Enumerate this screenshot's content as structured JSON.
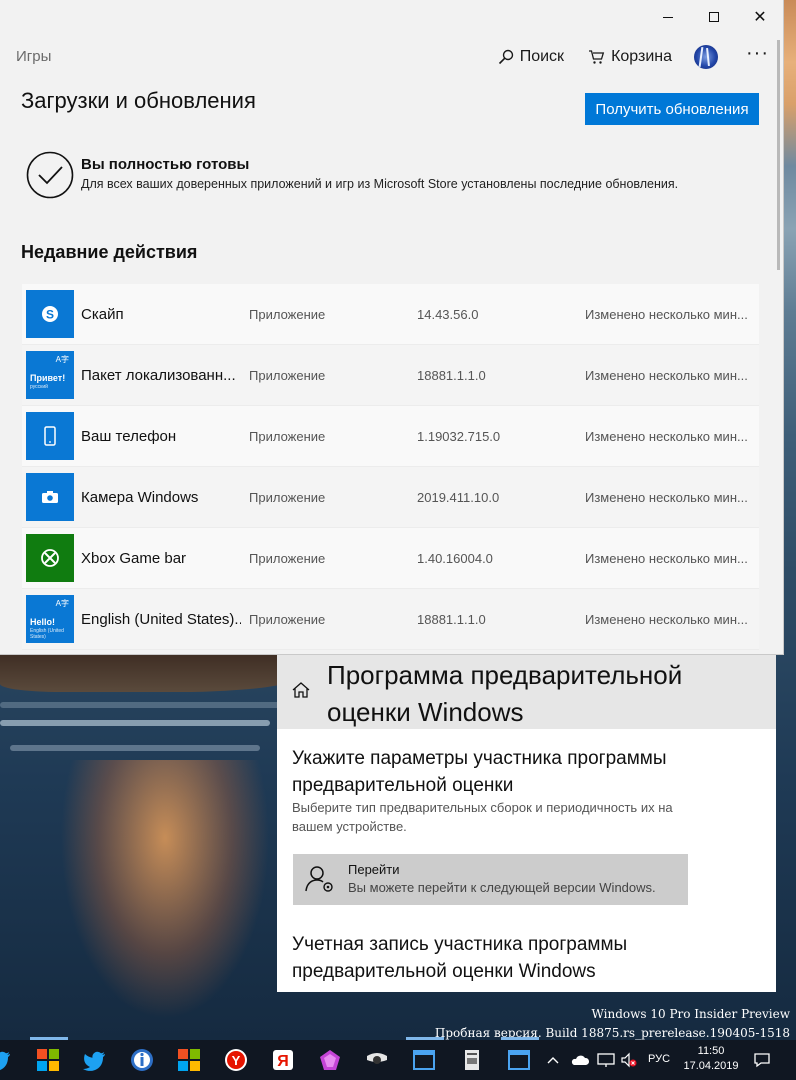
{
  "store": {
    "section": "Игры",
    "nav": {
      "search": "Поиск",
      "cart": "Корзина",
      "more": "···"
    },
    "page_title": "Загрузки и обновления",
    "get_updates_button": "Получить обновления",
    "status_title": "Вы полностью готовы",
    "status_desc": "Для всех ваших доверенных приложений и игр из Microsoft Store установлены последние обновления.",
    "recent_title": "Недавние действия",
    "rows": [
      {
        "name": "Скайп",
        "type": "Приложение",
        "version": "14.43.56.0",
        "status": "Изменено несколько мин...",
        "icon": "skype-icon"
      },
      {
        "name": "Пакет локализованн...",
        "type": "Приложение",
        "version": "18881.1.1.0",
        "status": "Изменено несколько мин...",
        "icon": "language-pack-icon",
        "tile_text": "Привет!",
        "tile_sub": "русский"
      },
      {
        "name": "Ваш телефон",
        "type": "Приложение",
        "version": "1.19032.715.0",
        "status": "Изменено несколько мин...",
        "icon": "phone-icon"
      },
      {
        "name": "Камера Windows",
        "type": "Приложение",
        "version": "2019.411.10.0",
        "status": "Изменено несколько мин...",
        "icon": "camera-icon"
      },
      {
        "name": "Xbox Game bar",
        "type": "Приложение",
        "version": "1.40.16004.0",
        "status": "Изменено несколько мин...",
        "icon": "xbox-icon"
      },
      {
        "name": "English (United States)...",
        "type": "Приложение",
        "version": "18881.1.1.0",
        "status": "Изменено несколько мин...",
        "icon": "language-pack-icon",
        "tile_text": "Hello!",
        "tile_sub": "English (United States)"
      }
    ]
  },
  "settings": {
    "title": "Программа предварительной оценки Windows",
    "heading": "Укажите параметры участника программы предварительной оценки",
    "description": "Выберите тип предварительных сборок и периодичность их на вашем устройстве.",
    "card_title": "Перейти",
    "card_subtitle": "Вы можете перейти к следующей версии Windows.",
    "heading2": "Учетная запись участника программы предварительной оценки Windows"
  },
  "watermark": {
    "line1": "Windows 10 Pro Insider Preview",
    "line2": "Пробная версия. Build 18875.rs_prerelease.190405-1518"
  },
  "taskbar": {
    "language": "РУС",
    "time": "11:50",
    "date": "17.04.2019"
  },
  "colors": {
    "accent": "#0078d7",
    "tile_blue": "#0a78d4",
    "tile_green": "#107c10",
    "taskbar": "#101722"
  }
}
